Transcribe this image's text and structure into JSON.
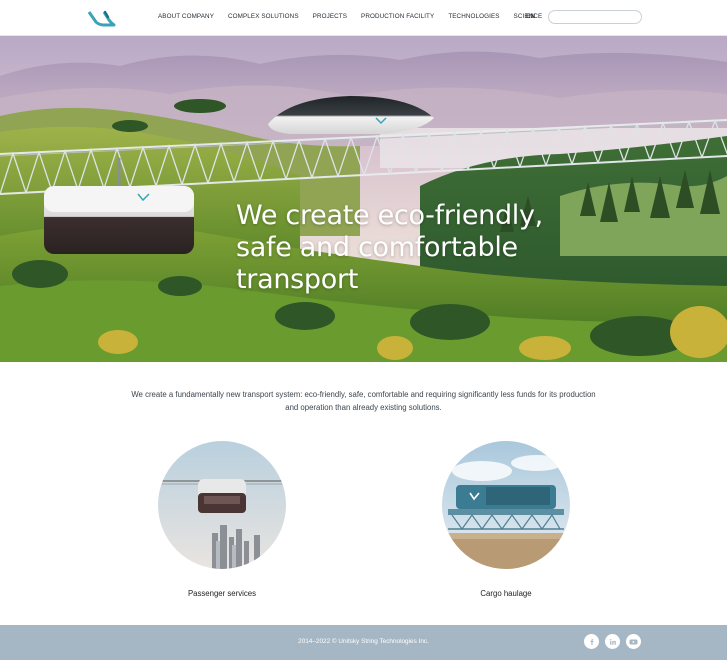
{
  "header": {
    "logo_icon": "unitsky-logo-icon",
    "nav": [
      {
        "label": "ABOUT COMPANY"
      },
      {
        "label": "COMPLEX SOLUTIONS"
      },
      {
        "label": "PROJECTS"
      },
      {
        "label": "PRODUCTION FACILITY"
      },
      {
        "label": "TECHNOLOGIES"
      },
      {
        "label": "SCIENCE"
      }
    ],
    "language": "EN",
    "search_placeholder": ""
  },
  "hero": {
    "title_line1": "We create eco-friendly,",
    "title_line2": "safe and comfortable",
    "title_line3": "transport"
  },
  "intro": {
    "text": "We create a fundamentally new transport system: eco-friendly, safe, comfortable and requiring significantly less funds for its production and operation than already existing solutions."
  },
  "services": [
    {
      "label": "Passenger services"
    },
    {
      "label": "Cargo haulage"
    }
  ],
  "footer": {
    "copyright": "2014–2022 © Unitsky String Technologies Inc.",
    "social": [
      "facebook-icon",
      "linkedin-icon",
      "youtube-icon"
    ]
  },
  "colors": {
    "accent": "#3aa3b7",
    "footer_bg": "#a5b6c4",
    "text_dark": "#1f2a33"
  }
}
